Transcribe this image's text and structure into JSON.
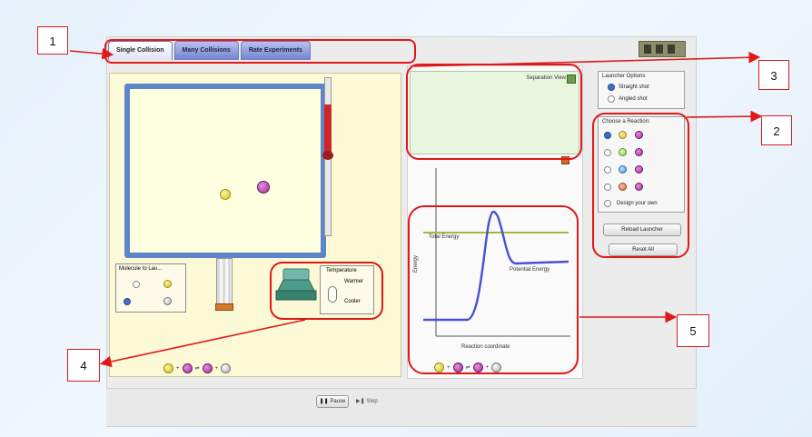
{
  "tabs": [
    {
      "label": "Single Collision",
      "active": true
    },
    {
      "label": "Many Collisions",
      "active": false
    },
    {
      "label": "Rate Experiments",
      "active": false
    }
  ],
  "molecule_launcher": {
    "title": "Molecule to Lau..."
  },
  "temperature": {
    "title": "Temperature",
    "options": [
      "Warmer",
      "Cooler"
    ]
  },
  "separation_view": {
    "label": "Separation View"
  },
  "energy_chart": {
    "ylabel": "Energy",
    "xlabel": "Reaction coordinate",
    "total_energy_label": "Total Energy",
    "potential_energy_label": "Potential Energy"
  },
  "launcher_options": {
    "title": "Launcher Options",
    "options": [
      {
        "label": "Straight shot",
        "selected": true
      },
      {
        "label": "Angled shot",
        "selected": false
      }
    ]
  },
  "reactions": {
    "title": "Choose a Reaction:",
    "custom_label": "Design your own"
  },
  "buttons": {
    "reload_launcher": "Reload Launcher",
    "reset_all": "Reset All"
  },
  "playback": {
    "pause": "Pause",
    "step": "Step"
  },
  "reaction_equation": {
    "arrow": "⇌"
  },
  "callouts": [
    "1",
    "2",
    "3",
    "4",
    "5"
  ],
  "colors": {
    "annotation_red": "#e01818",
    "tab_blue": "#7380cf",
    "box_border": "#5c86c9",
    "curve_blue": "#4a4fd6",
    "total_energy_line": "#a3b83a"
  }
}
